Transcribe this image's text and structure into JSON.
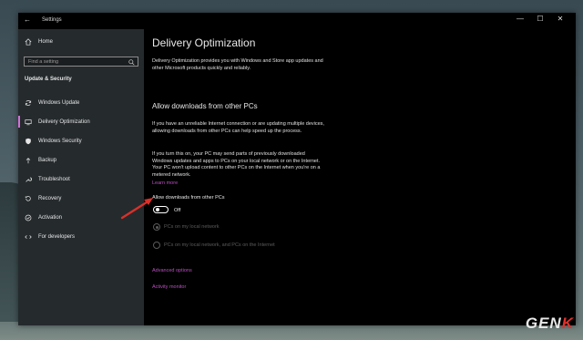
{
  "window": {
    "title": "Settings",
    "back_glyph": "←",
    "controls": [
      "—",
      "☐",
      "✕"
    ]
  },
  "sidebar": {
    "home_label": "Home",
    "search_placeholder": "Find a setting",
    "section_title": "Update & Security",
    "items": [
      {
        "label": "Windows Update",
        "icon": "sync-icon"
      },
      {
        "label": "Delivery Optimization",
        "icon": "delivery-icon",
        "selected": true
      },
      {
        "label": "Windows Security",
        "icon": "shield-icon"
      },
      {
        "label": "Backup",
        "icon": "backup-arrow-icon"
      },
      {
        "label": "Troubleshoot",
        "icon": "wrench-icon"
      },
      {
        "label": "Recovery",
        "icon": "recovery-icon"
      },
      {
        "label": "Activation",
        "icon": "check-circle-icon"
      },
      {
        "label": "For developers",
        "icon": "developer-icon"
      }
    ]
  },
  "main": {
    "title": "Delivery Optimization",
    "intro": "Delivery Optimization provides you with Windows and Store app updates and other Microsoft products quickly and reliably.",
    "section_heading": "Allow downloads from other PCs",
    "para1": "If you have an unreliable Internet connection or are updating multiple devices, allowing downloads from other PCs can help speed up the process.",
    "para2": "If you turn this on, your PC may send parts of previously downloaded Windows updates and apps to PCs on your local network or on the Internet. Your PC won't upload content to other PCs on the Internet when you're on a metered network.",
    "learn_more": "Learn more",
    "toggle_label": "Allow downloads from other PCs",
    "toggle_state": "Off",
    "radio1": "PCs on my local network",
    "radio2": "PCs on my local network, and PCs on the Internet",
    "advanced_link": "Advanced options",
    "activity_link": "Activity monitor"
  },
  "watermark": {
    "text_main": "GEN",
    "text_accent": "K"
  },
  "colors": {
    "accent": "#b94fc0",
    "arrow": "#d9302a",
    "window_bg": "#000000",
    "sidebar_bg": "#252a2d"
  }
}
